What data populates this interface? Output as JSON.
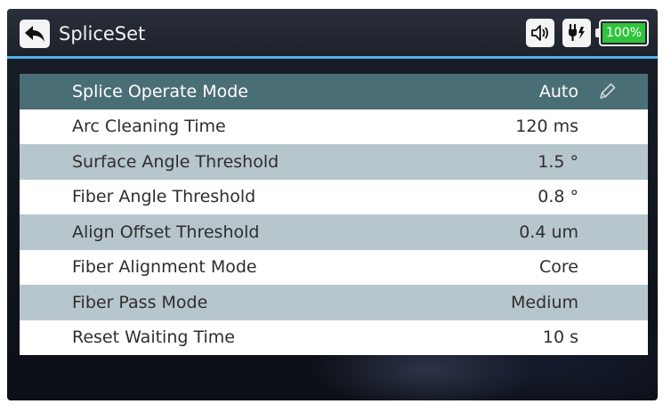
{
  "header": {
    "title": "SpliceSet",
    "battery_text": "100%",
    "icons": {
      "back": "back-arrow-icon",
      "sound": "speaker-icon",
      "power": "power-plug-icon",
      "battery": "battery-icon"
    }
  },
  "settings": {
    "items": [
      {
        "label": "Splice Operate Mode",
        "value": "Auto"
      },
      {
        "label": "Arc Cleaning Time",
        "value": "120 ms"
      },
      {
        "label": "Surface Angle Threshold",
        "value": "1.5 °"
      },
      {
        "label": "Fiber Angle Threshold",
        "value": "0.8 °"
      },
      {
        "label": "Align Offset Threshold",
        "value": "0.4 um"
      },
      {
        "label": "Fiber Alignment Mode",
        "value": "Core"
      },
      {
        "label": "Fiber Pass Mode",
        "value": "Medium"
      },
      {
        "label": "Reset Waiting Time",
        "value": "10 s"
      }
    ],
    "selected_index": 0
  },
  "colors": {
    "accent_line": "#4fb3e6",
    "selected_row": "#4a6e76",
    "alt_row": "#b7c6cc",
    "battery_fill": "#2fc43b"
  }
}
